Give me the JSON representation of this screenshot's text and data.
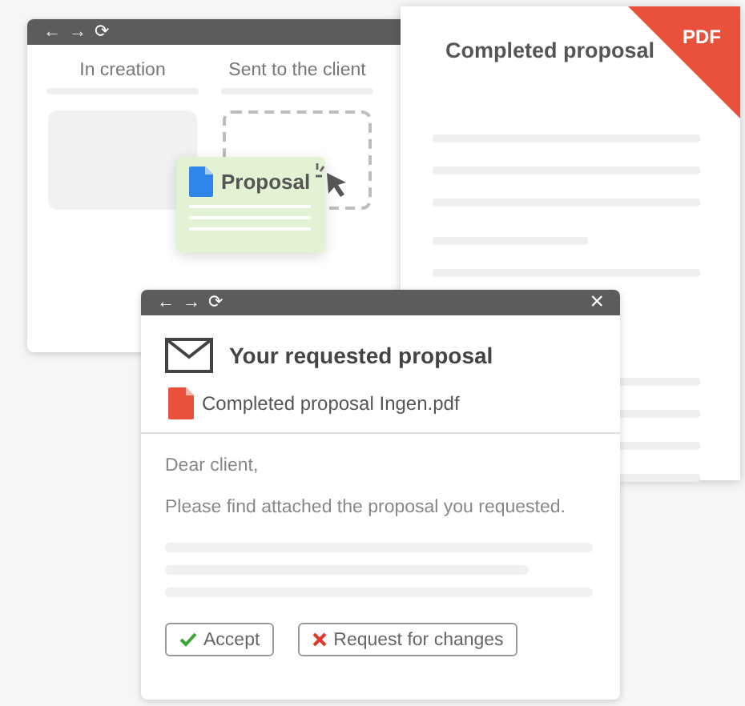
{
  "back_window": {
    "nav": [
      "←",
      "→",
      "⟳"
    ],
    "columns": [
      {
        "heading": "In creation",
        "kind": "filled"
      },
      {
        "heading": "Sent to the client",
        "kind": "dropzone"
      }
    ]
  },
  "drag_card": {
    "label": "Proposal"
  },
  "pdf_document": {
    "title": "Completed proposal",
    "badge": "PDF"
  },
  "email_window": {
    "nav": [
      "←",
      "→",
      "⟳"
    ],
    "close": "×",
    "subject": "Your requested proposal",
    "attachment": "Completed proposal Ingen.pdf",
    "greeting": "Dear client,",
    "body": "Please find attached the proposal you requested.",
    "buttons": [
      {
        "label": "Accept",
        "kind": "accept"
      },
      {
        "label": "Request for changes",
        "kind": "reject"
      }
    ]
  }
}
